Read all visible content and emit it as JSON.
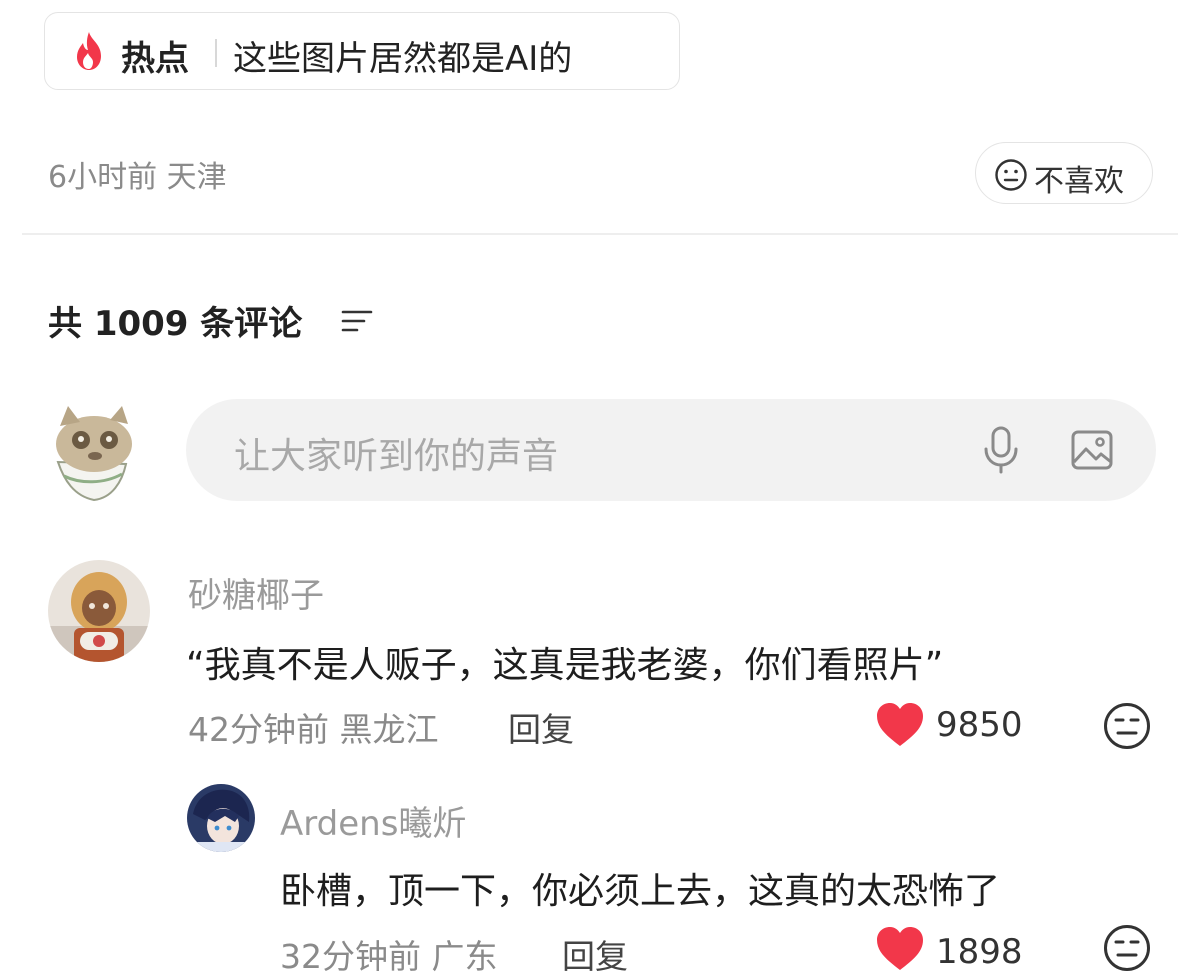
{
  "hot_topic": {
    "badge": "热点",
    "title": "这些图片居然都是AI的"
  },
  "post_meta": {
    "time_location": "6小时前 天津"
  },
  "dislike": {
    "label": "不喜欢",
    "icon": "neutral-face-icon"
  },
  "comments_header": {
    "text": "共 1009 条评论",
    "icon": "sort-icon"
  },
  "comment_input": {
    "placeholder": "让大家听到你的声音",
    "icons": [
      "microphone-icon",
      "image-icon"
    ]
  },
  "comments": [
    {
      "username": "砂糖椰子",
      "text": "“我真不是人贩子，这真是我老婆，你们看照片”",
      "meta": "42分钟前 黑龙江",
      "reply_label": "回复",
      "likes": "9850"
    },
    {
      "username": "Ardens曦炘",
      "text": "卧槽，顶一下，你必须上去，这真的太恐怖了",
      "meta": "32分钟前 广东",
      "reply_label": "回复",
      "likes": "1898"
    }
  ],
  "colors": {
    "accent_red": "#f2374a",
    "text_primary": "#222222",
    "text_muted": "#8a8a8a",
    "input_bg": "#f2f2f2"
  }
}
